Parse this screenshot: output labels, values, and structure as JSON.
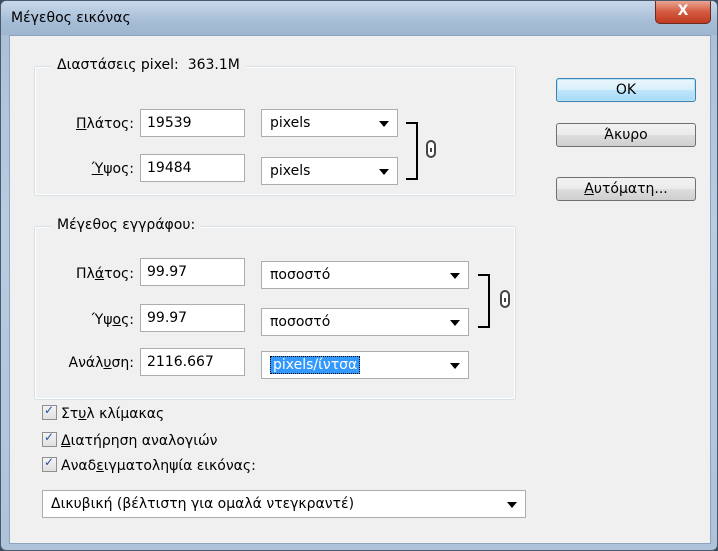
{
  "window": {
    "title": "Μέγεθος εικόνας",
    "close_label": "X"
  },
  "pixel_dimensions": {
    "group_label": "Διαστάσεις pixel:",
    "size_value": "363.1M",
    "width": {
      "label_prefix": "",
      "label_underlined": "Π",
      "label_rest": "λάτος:",
      "value": "19539",
      "unit": "pixels"
    },
    "height": {
      "label_prefix": "",
      "label_underlined": "Ύ",
      "label_rest": "ψος:",
      "value": "19484",
      "unit": "pixels"
    }
  },
  "document_size": {
    "group_label": "Μέγεθος εγγράφου:",
    "width": {
      "label_prefix": "Πλ",
      "label_underlined": "ά",
      "label_rest": "τος:",
      "value": "99.97",
      "unit": "ποσοστό"
    },
    "height": {
      "label_prefix": "Ύψ",
      "label_underlined": "ο",
      "label_rest": "ς:",
      "value": "99.97",
      "unit": "ποσοστό"
    },
    "resolution": {
      "label_prefix": "Ανάλ",
      "label_underlined": "υ",
      "label_rest": "ση:",
      "value": "2116.667",
      "unit": "pixels/ίντσα"
    }
  },
  "buttons": {
    "ok": "OK",
    "cancel": "Άκυρο",
    "auto_underlined": "Α",
    "auto_rest": "υτόματη..."
  },
  "checkboxes": [
    {
      "prefix": "Στ",
      "underlined": "υ",
      "rest": "λ κλίμακας",
      "checked": true
    },
    {
      "prefix": "",
      "underlined": "Δ",
      "rest": "ιατήρηση αναλογιών",
      "checked": true
    },
    {
      "prefix": "Αναδ",
      "underlined": "ε",
      "rest": "ιγματοληψία εικόνας:",
      "checked": true
    }
  ],
  "resample_method": "Δικυβική (βέλτιστη για ομαλά ντεγκραντέ)"
}
